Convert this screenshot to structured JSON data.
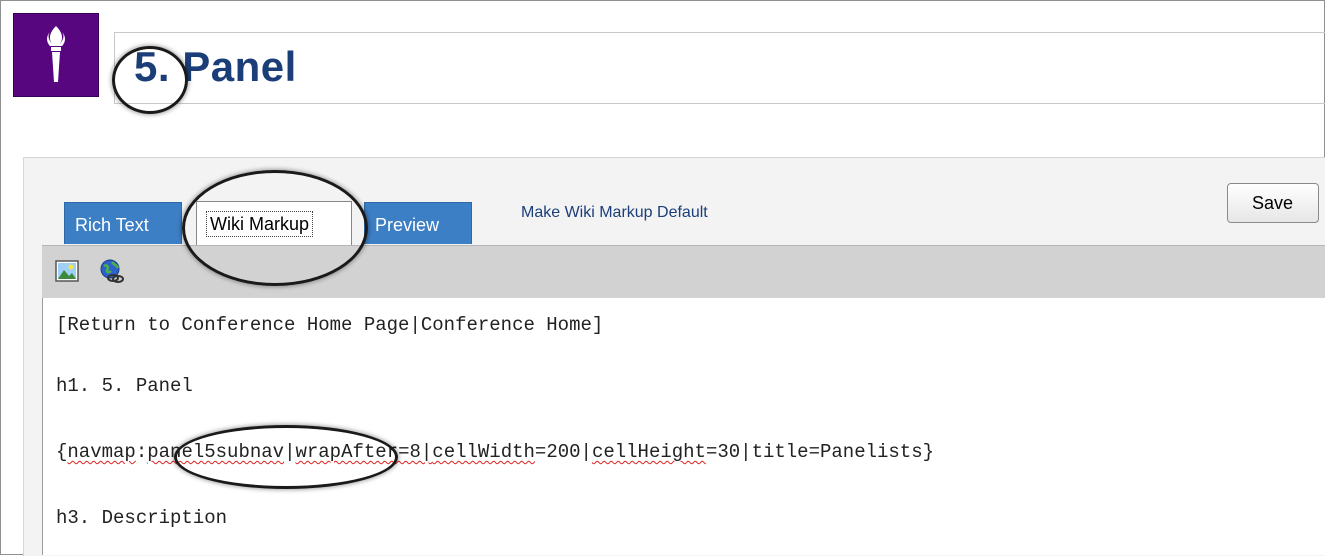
{
  "header": {
    "number": "5.",
    "title": "Panel"
  },
  "tabs": [
    {
      "label": "Rich Text",
      "active": false
    },
    {
      "label": "Wiki Markup",
      "active": true
    },
    {
      "label": "Preview",
      "active": false
    }
  ],
  "make_default_link": "Make Wiki Markup Default",
  "save_label": "Save",
  "toolbar_icons": [
    "insert-image-icon",
    "insert-link-icon"
  ],
  "editor": {
    "line1": "[Return to Conference Home Page|Conference Home]",
    "line2": "h1. 5. Panel",
    "line3": {
      "open": "{",
      "macro": "navmap",
      "sep1": ":",
      "param": "panel5subnav",
      "sep2": "|",
      "wrap": "wrapAfter=8|",
      "cellwidth_key": "cellWidth",
      "cellwidth_val": "=200|",
      "cellheight_key": "cellHeight",
      "rest": "=30|title=Panelists}"
    },
    "line4": "h3. Description"
  },
  "colors": {
    "brand_purple": "#57067f",
    "title_blue": "#1b3e78",
    "tab_blue": "#3c7fc5"
  }
}
